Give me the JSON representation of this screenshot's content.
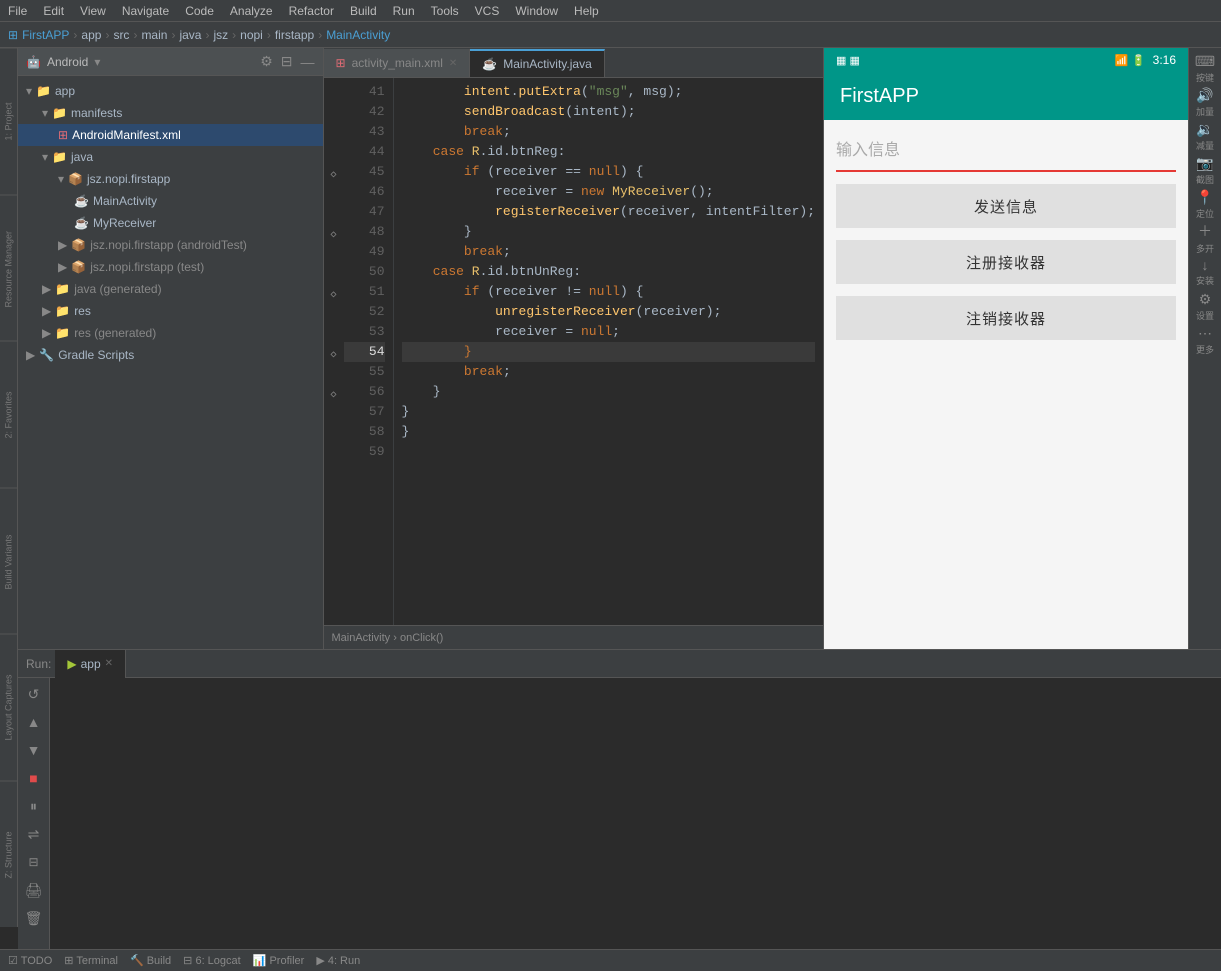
{
  "menubar": {
    "items": [
      "File",
      "Edit",
      "View",
      "Navigate",
      "Code",
      "Analyze",
      "Refactor",
      "Build",
      "Run",
      "Tools",
      "VCS",
      "Window",
      "Help"
    ]
  },
  "pathbar": {
    "segments": [
      "FirstAPP",
      "app",
      "src",
      "main",
      "java",
      "jsz",
      "nopi",
      "firstapp",
      "MainActivity"
    ]
  },
  "project": {
    "title": "Android",
    "tree": [
      {
        "level": 0,
        "label": "app",
        "type": "folder",
        "expanded": true
      },
      {
        "level": 1,
        "label": "manifests",
        "type": "folder",
        "expanded": true
      },
      {
        "level": 2,
        "label": "AndroidManifest.xml",
        "type": "xml",
        "selected": true
      },
      {
        "level": 1,
        "label": "java",
        "type": "folder",
        "expanded": true
      },
      {
        "level": 2,
        "label": "jsz.nopi.firstapp",
        "type": "package",
        "expanded": true
      },
      {
        "level": 3,
        "label": "MainActivity",
        "type": "java",
        "expanded": false
      },
      {
        "level": 3,
        "label": "MyReceiver",
        "type": "java",
        "expanded": false
      },
      {
        "level": 2,
        "label": "jsz.nopi.firstapp (androidTest)",
        "type": "package",
        "expanded": false
      },
      {
        "level": 2,
        "label": "jsz.nopi.firstapp (test)",
        "type": "package",
        "expanded": false
      },
      {
        "level": 1,
        "label": "java (generated)",
        "type": "folder",
        "expanded": false
      },
      {
        "level": 1,
        "label": "res",
        "type": "folder",
        "expanded": false
      },
      {
        "level": 1,
        "label": "res (generated)",
        "type": "folder",
        "expanded": false
      },
      {
        "level": 0,
        "label": "Gradle Scripts",
        "type": "folder",
        "expanded": false
      }
    ]
  },
  "editor": {
    "tabs": [
      {
        "label": "activity_main.xml",
        "active": false,
        "closeable": true
      },
      {
        "label": "MainActivity.java",
        "active": true,
        "closeable": false
      }
    ],
    "lines": [
      {
        "num": 41,
        "gutter": "",
        "code": "        intent.putExtra"
      },
      {
        "num": 42,
        "gutter": "",
        "code": "        sendBroadcast(i"
      },
      {
        "num": 43,
        "gutter": "",
        "code": "        break;"
      },
      {
        "num": 44,
        "gutter": "",
        "code": "    case R.id.btnReg:"
      },
      {
        "num": 45,
        "gutter": "◇",
        "code": "        if (receiver =="
      },
      {
        "num": 46,
        "gutter": "",
        "code": "            receiver ="
      },
      {
        "num": 47,
        "gutter": "",
        "code": "            registerRec"
      },
      {
        "num": 48,
        "gutter": "◇",
        "code": "        }"
      },
      {
        "num": 49,
        "gutter": "",
        "code": "        break;"
      },
      {
        "num": 50,
        "gutter": "",
        "code": "    case R.id.btnUnReg:"
      },
      {
        "num": 51,
        "gutter": "◇",
        "code": "        if (receiver !="
      },
      {
        "num": 52,
        "gutter": "",
        "code": "            unregisterR"
      },
      {
        "num": 53,
        "gutter": "",
        "code": "            receiver ="
      },
      {
        "num": 54,
        "gutter": "◇",
        "code": "        }"
      },
      {
        "num": 55,
        "gutter": "",
        "code": "        break;"
      },
      {
        "num": 56,
        "gutter": "◇",
        "code": "    }"
      },
      {
        "num": 57,
        "gutter": "",
        "code": "}"
      },
      {
        "num": 58,
        "gutter": "",
        "code": "}"
      },
      {
        "num": 59,
        "gutter": "",
        "code": ""
      }
    ],
    "breadcrumb": "MainActivity › onClick()"
  },
  "emulator": {
    "app_name": "FirstAPP",
    "status_left": "▦",
    "status_right": "3:16",
    "input_placeholder": "输入信息",
    "buttons": [
      "发送信息",
      "注册接收器",
      "注销接收器"
    ]
  },
  "right_toolbar": {
    "buttons": [
      {
        "icon": "⌨",
        "label": "按键"
      },
      {
        "icon": "🔊",
        "label": "加量"
      },
      {
        "icon": "🔉",
        "label": "减量"
      },
      {
        "icon": "📷",
        "label": "截图"
      },
      {
        "icon": "📍",
        "label": "定位"
      },
      {
        "icon": "＋",
        "label": "多开"
      },
      {
        "icon": "↓",
        "label": "安装"
      },
      {
        "icon": "⚙",
        "label": "设置"
      },
      {
        "icon": "⋯",
        "label": "更多"
      }
    ]
  },
  "bottom_panel": {
    "run_label": "Run:",
    "tab_label": "app",
    "run_content": ""
  },
  "statusbar": {
    "left_items": [
      "TODO",
      "Terminal",
      "Build",
      "6: Logcat",
      "Profiler",
      "4: Run"
    ],
    "right_items": []
  },
  "left_edge": {
    "items": [
      "1: Project",
      "Resource Manager",
      "2: Favorites",
      "Build Variants",
      "Layout Captures",
      "Z: Structure"
    ]
  }
}
